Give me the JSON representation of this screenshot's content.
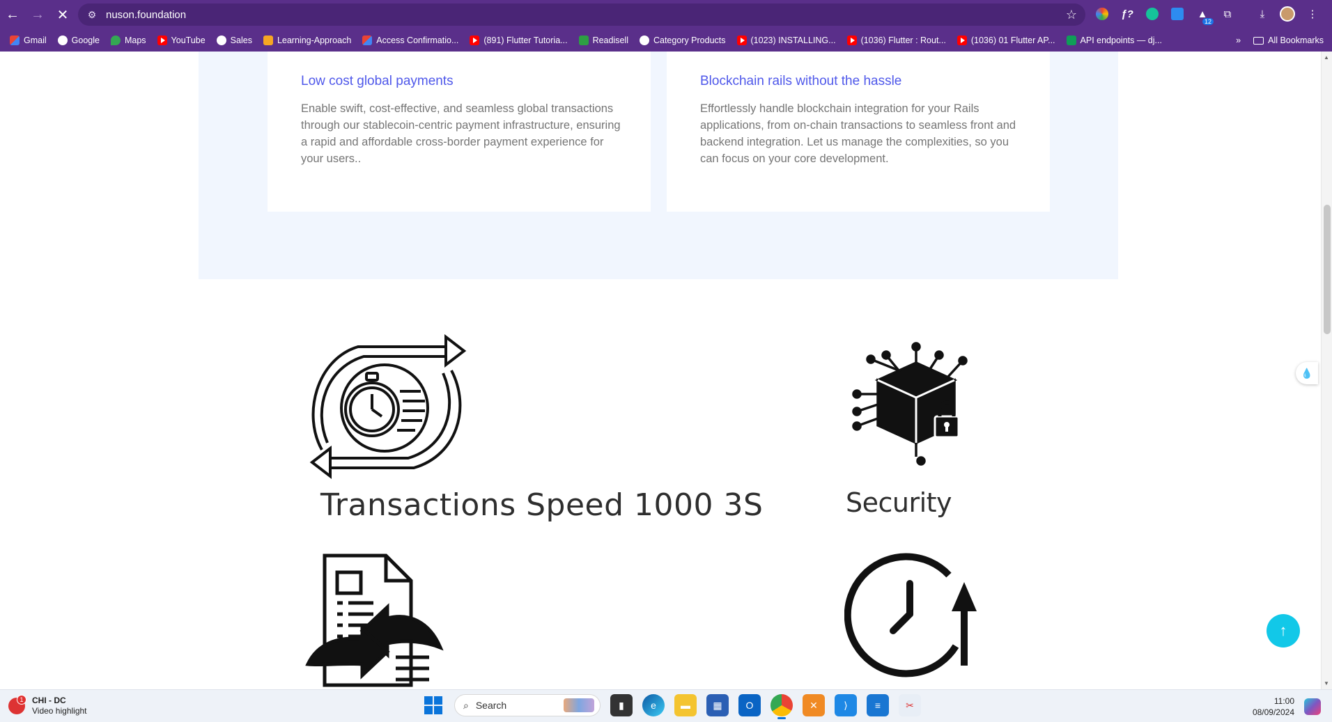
{
  "browser": {
    "url": "nuson.foundation",
    "extensions_badge": "12",
    "bookmarks": [
      {
        "label": "Gmail",
        "icon": "gmail-icon"
      },
      {
        "label": "Google",
        "icon": "google-icon"
      },
      {
        "label": "Maps",
        "icon": "maps-icon"
      },
      {
        "label": "YouTube",
        "icon": "youtube-icon"
      },
      {
        "label": "Sales",
        "icon": "globe-icon"
      },
      {
        "label": "Learning-Approach",
        "icon": "learning-icon"
      },
      {
        "label": "Access Confirmatio...",
        "icon": "gmail-icon"
      },
      {
        "label": "(891) Flutter Tutoria...",
        "icon": "youtube-icon"
      },
      {
        "label": "Readisell",
        "icon": "readisell-icon"
      },
      {
        "label": "Category Products",
        "icon": "category-icon"
      },
      {
        "label": "(1023) INSTALLING...",
        "icon": "youtube-icon"
      },
      {
        "label": "(1036) Flutter : Rout...",
        "icon": "youtube-icon"
      },
      {
        "label": "(1036) 01 Flutter AP...",
        "icon": "youtube-icon"
      },
      {
        "label": "API endpoints — dj...",
        "icon": "sheet-icon"
      }
    ],
    "more_bookmarks": "»",
    "all_bookmarks": "All Bookmarks"
  },
  "cards": [
    {
      "title": "Low cost global payments",
      "body": "Enable swift, cost-effective, and seamless global transactions through our stablecoin-centric payment infrastructure, ensuring a rapid and affordable cross-border payment experience for your users.."
    },
    {
      "title": "Blockchain rails without the hassle",
      "body": "Effortlessly handle blockchain integration for your Rails applications, from on-chain transactions to seamless front and backend integration. Let us manage the complexities, so you can focus on your core development."
    }
  ],
  "features": {
    "speed_label": "Transactions Speed 1000 3S",
    "security_label": "Security"
  },
  "taskbar": {
    "weather_title": "CHI - DC",
    "weather_sub": "Video highlight",
    "weather_badge": "1",
    "search_placeholder": "Search",
    "time": "11:00",
    "date": "08/09/2024"
  }
}
